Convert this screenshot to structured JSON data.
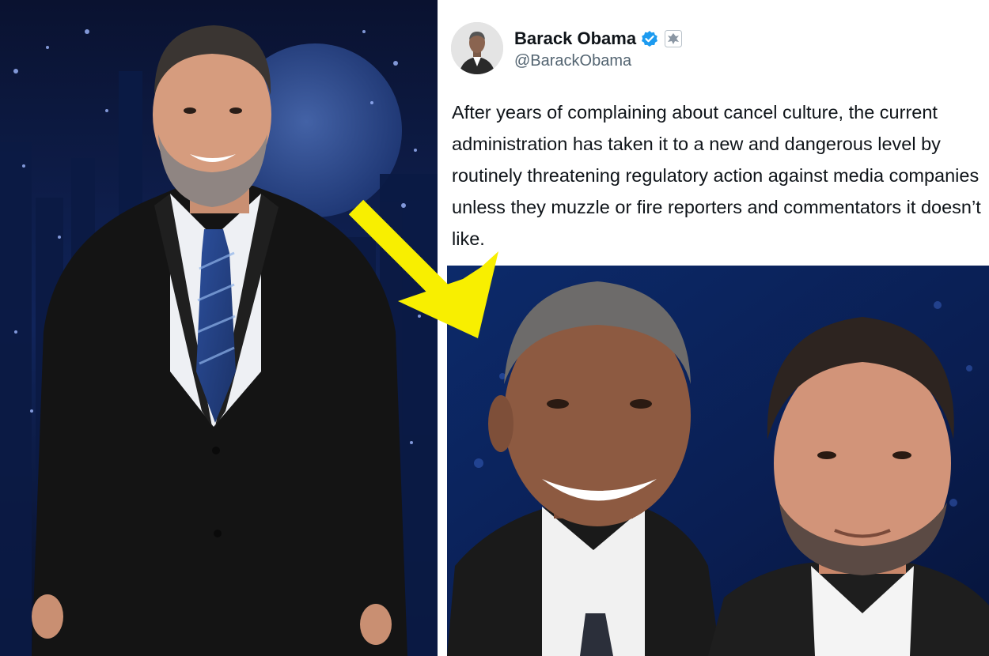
{
  "tweet": {
    "display_name": "Barack Obama",
    "handle": "@BarackObama",
    "verified_icon": "verified-badge-icon",
    "gov_icon": "government-seal-icon",
    "text": "After years of complaining about cancel culture, the current administration has taken it to a new and dangerous level by routinely threatening regulatory action against media companies unless they muzzle or fire reporters and commentators it doesn’t like."
  },
  "colors": {
    "arrow": "#f8ef00",
    "verified": "#1d9bf0",
    "stage_blue": "#0d1f4c",
    "handle_gray": "#536471"
  }
}
